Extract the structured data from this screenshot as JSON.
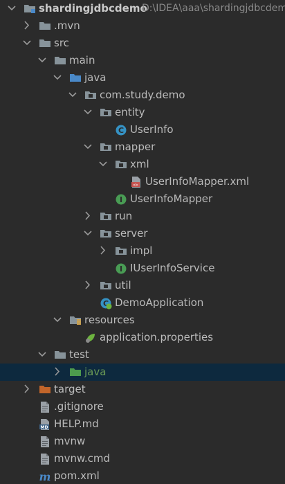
{
  "project": {
    "name": "shardingjdbcdemo",
    "path": "D:\\IDEA\\aaa\\shardingjdbcdemo"
  },
  "colors": {
    "background": "#2b2b2b",
    "selection": "#0d293e",
    "text": "#bbbbbb",
    "folder": "#87939a",
    "source_folder": "#4a89c8",
    "test_folder": "#4d9a4d",
    "excluded_folder": "#c2652a",
    "class_icon": "#3592c4",
    "interface_icon": "#499c54"
  },
  "tree": [
    {
      "id": "shardingjdbcdemo",
      "depth": 0,
      "arrow": "down",
      "icon": "module-folder-icon",
      "label": "shardingjdbcdemo",
      "bold": true,
      "path": "D:\\IDEA\\aaa\\shardingjdbcdemo"
    },
    {
      "id": "mvn",
      "depth": 1,
      "arrow": "right",
      "icon": "folder-icon",
      "label": ".mvn"
    },
    {
      "id": "src",
      "depth": 1,
      "arrow": "down",
      "icon": "folder-icon",
      "label": "src"
    },
    {
      "id": "main",
      "depth": 2,
      "arrow": "down",
      "icon": "folder-icon",
      "label": "main"
    },
    {
      "id": "java-main",
      "depth": 3,
      "arrow": "down",
      "icon": "source-folder-icon",
      "label": "java"
    },
    {
      "id": "com-study-demo",
      "depth": 4,
      "arrow": "down",
      "icon": "package-icon",
      "label": "com.study.demo"
    },
    {
      "id": "entity",
      "depth": 5,
      "arrow": "down",
      "icon": "package-icon",
      "label": "entity"
    },
    {
      "id": "userinfo",
      "depth": 6,
      "arrow": "none",
      "icon": "class-icon",
      "label": "UserInfo"
    },
    {
      "id": "mapper",
      "depth": 5,
      "arrow": "down",
      "icon": "package-icon",
      "label": "mapper"
    },
    {
      "id": "xml",
      "depth": 6,
      "arrow": "down",
      "icon": "package-icon",
      "label": "xml"
    },
    {
      "id": "userinfomapper-xml",
      "depth": 7,
      "arrow": "none",
      "icon": "xml-file-icon",
      "label": "UserInfoMapper.xml"
    },
    {
      "id": "userinfomapper",
      "depth": 6,
      "arrow": "none",
      "icon": "interface-icon",
      "label": "UserInfoMapper"
    },
    {
      "id": "run",
      "depth": 5,
      "arrow": "right",
      "icon": "package-icon",
      "label": "run"
    },
    {
      "id": "server",
      "depth": 5,
      "arrow": "down",
      "icon": "package-icon",
      "label": "server"
    },
    {
      "id": "impl",
      "depth": 6,
      "arrow": "right",
      "icon": "package-icon",
      "label": "impl"
    },
    {
      "id": "iuserinfoservice",
      "depth": 6,
      "arrow": "none",
      "icon": "interface-icon",
      "label": "IUserInfoService"
    },
    {
      "id": "util",
      "depth": 5,
      "arrow": "right",
      "icon": "package-icon",
      "label": "util"
    },
    {
      "id": "demoapplication",
      "depth": 5,
      "arrow": "none",
      "icon": "spring-boot-class-icon",
      "label": "DemoApplication"
    },
    {
      "id": "resources",
      "depth": 3,
      "arrow": "down",
      "icon": "resources-folder-icon",
      "label": "resources"
    },
    {
      "id": "application-properties",
      "depth": 4,
      "arrow": "none",
      "icon": "spring-properties-icon",
      "label": "application.properties"
    },
    {
      "id": "test",
      "depth": 2,
      "arrow": "down",
      "icon": "folder-icon",
      "label": "test"
    },
    {
      "id": "java-test",
      "depth": 3,
      "arrow": "right",
      "icon": "test-folder-icon",
      "label": "java",
      "selected": true,
      "green": true
    },
    {
      "id": "target",
      "depth": 1,
      "arrow": "right",
      "icon": "excluded-folder-icon",
      "label": "target"
    },
    {
      "id": "gitignore",
      "depth": 1,
      "arrow": "none",
      "icon": "text-file-icon",
      "label": ".gitignore"
    },
    {
      "id": "help-md",
      "depth": 1,
      "arrow": "none",
      "icon": "markdown-file-icon",
      "label": "HELP.md"
    },
    {
      "id": "mvnw",
      "depth": 1,
      "arrow": "none",
      "icon": "text-file-icon",
      "label": "mvnw"
    },
    {
      "id": "mvnw-cmd",
      "depth": 1,
      "arrow": "none",
      "icon": "text-file-icon",
      "label": "mvnw.cmd"
    },
    {
      "id": "pom-xml",
      "depth": 1,
      "arrow": "none",
      "icon": "maven-file-icon",
      "label": "pom.xml"
    }
  ]
}
